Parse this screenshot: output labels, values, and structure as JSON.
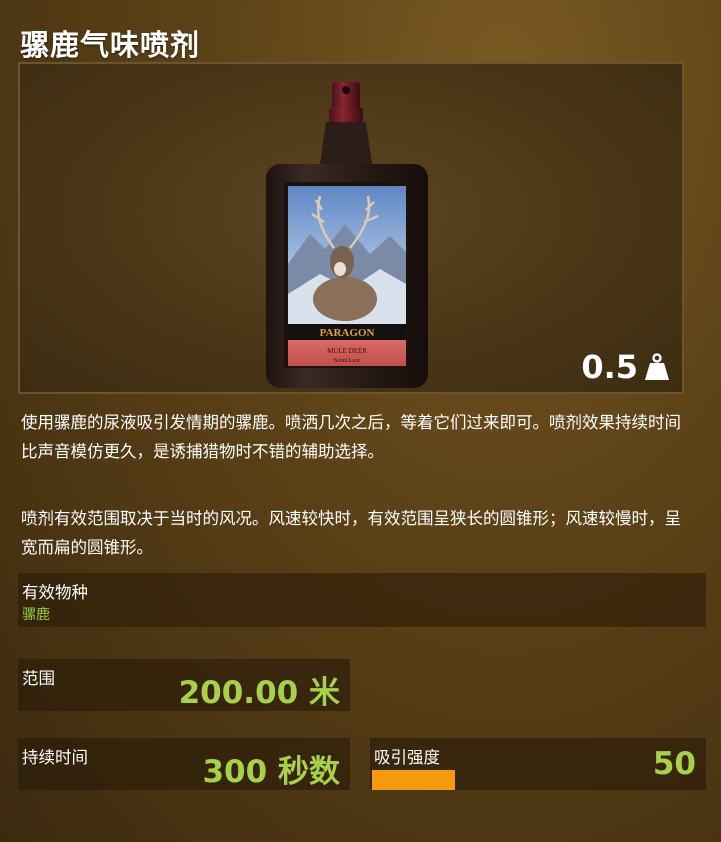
{
  "item": {
    "title": "骡鹿气味喷剂",
    "weight": "0.5",
    "weight_icon": "weight-icon"
  },
  "bottle": {
    "brand": "PARAGON",
    "label_line1": "MULE DEER",
    "label_line2": "Scent Lure"
  },
  "description": {
    "paragraph1": "使用骡鹿的尿液吸引发情期的骡鹿。喷洒几次之后，等着它们过来即可。喷剂效果持续时间比声音模仿更久，是诱捕猎物时不错的辅助选择。",
    "paragraph2": "喷剂有效范围取决于当时的风况。风速较快时，有效范围呈狭长的圆锥形；风速较慢时，呈宽而扁的圆锥形。"
  },
  "species": {
    "label": "有效物种",
    "value": "骡鹿"
  },
  "stats": {
    "range_label": "范围",
    "range_value": "200.00 米",
    "duration_label": "持续时间",
    "duration_value": "300 秒数",
    "attract_label": "吸引强度",
    "attract_value": "50",
    "attract_fraction": 0.5
  },
  "colors": {
    "accent_green": "#a8d14a",
    "species_green": "#9ccc3a",
    "bar_orange": "#f59a0c"
  }
}
